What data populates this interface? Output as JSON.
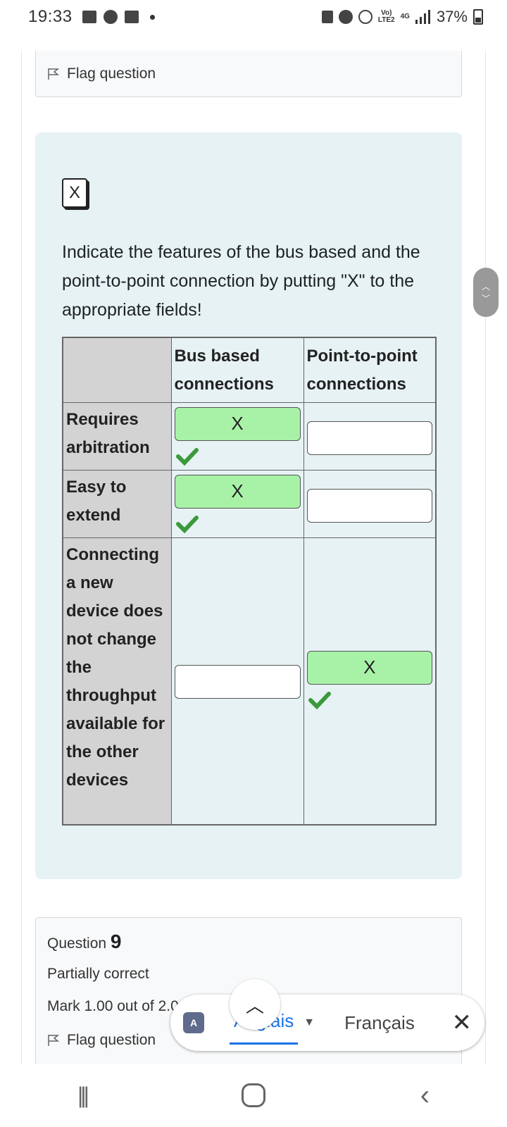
{
  "status": {
    "time": "19:33",
    "network_top": "Vo)",
    "network_bottom": "LTE2",
    "signal_label": "4G",
    "battery": "37%"
  },
  "flag_card": {
    "label": "Flag question"
  },
  "question": {
    "x_button": "X",
    "text": "Indicate the features of the bus based and the point-to-point connection by putting \"X\" to the appropriate fields!",
    "columns": [
      "Bus based connections",
      "Point-to-point connections"
    ],
    "rows": [
      {
        "label": "Requires arbitration",
        "bus": "X",
        "p2p": ""
      },
      {
        "label": "Easy to extend",
        "bus": "X",
        "p2p": ""
      },
      {
        "label": "Connecting a new device does not change the throughput available for the other devices",
        "bus": "",
        "p2p": "X"
      }
    ]
  },
  "question9": {
    "prefix": "Question",
    "number": "9",
    "state": "Partially correct",
    "mark": "Mark 1.00 out of 2.00",
    "flag_label": "Flag question"
  },
  "translate": {
    "icon_label": "A",
    "from_lang": "Anglais",
    "to_lang": "Français",
    "close": "✕",
    "collapse": "︿"
  },
  "colors": {
    "correct_fill": "#a8f2a8",
    "panel_bg": "#e7f2f5",
    "check_green": "#3a9a3a",
    "link_blue": "#1a73e8"
  }
}
